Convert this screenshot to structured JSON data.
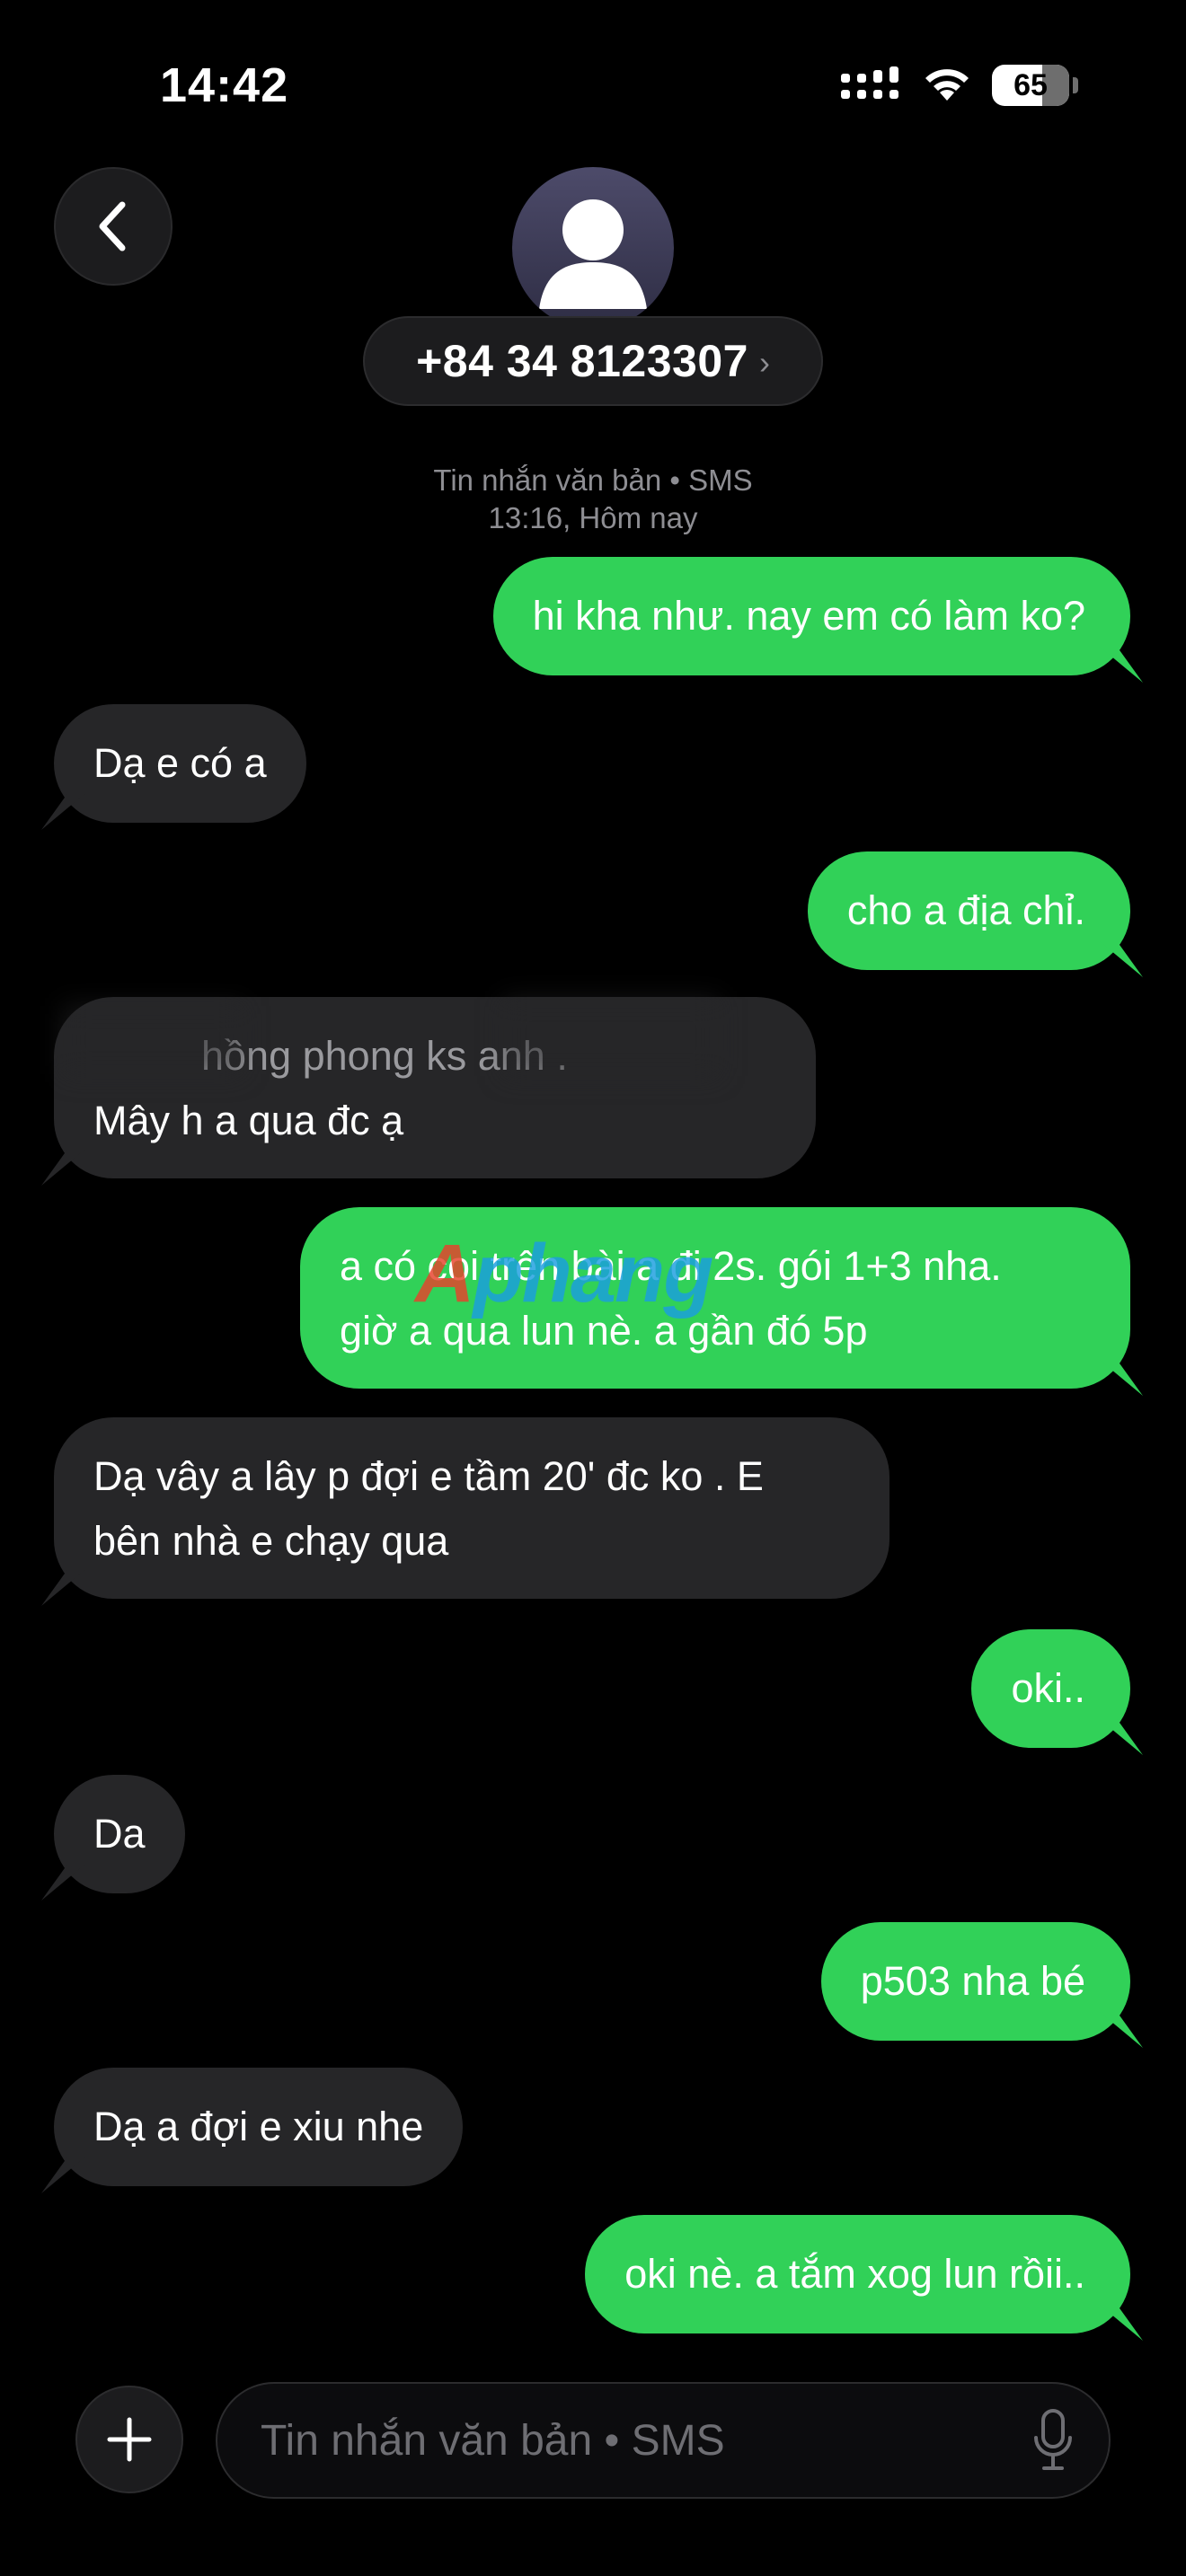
{
  "status_bar": {
    "time": "14:42",
    "battery_text": "65",
    "battery_level": 0.65
  },
  "header": {
    "back_icon": "chevron-left-icon",
    "avatar_icon": "person-icon",
    "contact_number": "+84 34 8123307",
    "contact_chevron": "›"
  },
  "conversation_meta": {
    "service_label": "Tin nhắn văn bản • SMS",
    "timestamp": "13:16, Hôm nay"
  },
  "messages": [
    {
      "direction": "sent",
      "lines": [
        "hi kha như. nay em có làm ko?"
      ]
    },
    {
      "direction": "received",
      "lines": [
        "Dạ e có a"
      ]
    },
    {
      "direction": "sent",
      "lines": [
        "cho a địa chỉ."
      ]
    },
    {
      "direction": "received",
      "lines": [
        "hồng phong ks anh .",
        "Mây h a qua đc ạ"
      ],
      "partially_redacted": true
    },
    {
      "direction": "sent",
      "lines": [
        "a có coi trên bài a đi 2s. gói 1+3 nha.",
        "giờ a qua lun nè. a gần đó 5p"
      ]
    },
    {
      "direction": "received",
      "lines": [
        "Dạ vây a lây p đợi e tầm 20' đc ko . E",
        "bên nhà e chạy qua"
      ]
    },
    {
      "direction": "sent",
      "lines": [
        "oki.."
      ]
    },
    {
      "direction": "received",
      "lines": [
        "Da"
      ]
    },
    {
      "direction": "sent",
      "lines": [
        "p503 nha bé"
      ]
    },
    {
      "direction": "received",
      "lines": [
        "Dạ a đợi e xiu nhe"
      ]
    },
    {
      "direction": "sent",
      "lines": [
        "oki nè. a tắm xog lun rồii.."
      ]
    }
  ],
  "watermark": {
    "first_letter": "A",
    "rest": "phang"
  },
  "composer": {
    "plus_icon": "plus-icon",
    "placeholder": "Tin nhắn văn bản • SMS",
    "value": "",
    "mic_icon": "microphone-icon"
  },
  "colors": {
    "sent_bubble": "#31d158",
    "received_bubble": "#262628",
    "background": "#000000",
    "secondary_text": "#8e8e93"
  }
}
